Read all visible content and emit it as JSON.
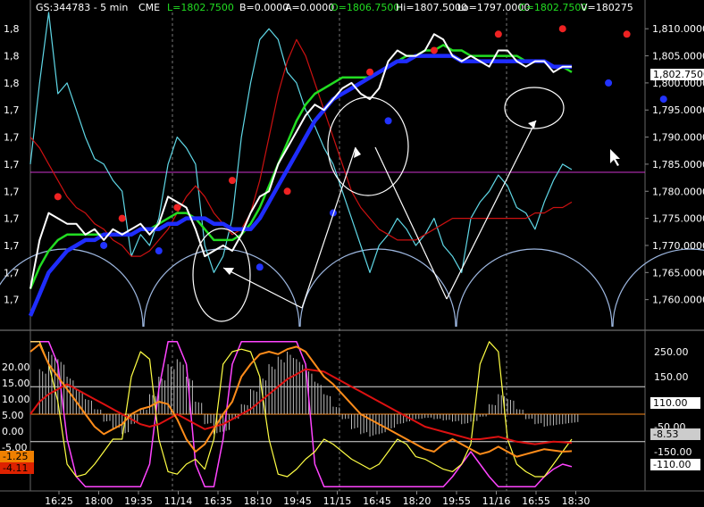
{
  "header": {
    "symbol": "GS:344783 - 5 min",
    "exchange": "CME",
    "last": "L=1802.7500",
    "bid": "B=0.0000",
    "ask": "A=0.0000",
    "open": "O=1806.7500",
    "high": "Hi=1807.5000",
    "low": "Lo=1797.0000",
    "close": "C=1802.7500",
    "volume": "V=180275"
  },
  "colors": {
    "background": "#000000",
    "price": "#ffffff",
    "ma_blue": "#1f2dff",
    "ma_green": "#22dd22",
    "ma_red": "#cc1111",
    "cyan_line": "#5fd7e6",
    "dot_red": "#ee2222",
    "dot_blue": "#2233ff",
    "arcs": "#9db7e0",
    "magenta_level": "#cc33cc",
    "osc_yellow": "#ffff44",
    "osc_orange": "#ff8c1a",
    "osc_red": "#dd1111",
    "osc_magenta": "#ff44ff",
    "osc_histogram": "#bbbbbb"
  },
  "chart_data": [
    {
      "type": "line",
      "panel": "price",
      "right_axis_ticks": [
        "1,810.0000",
        "1,805.0000",
        "1,800.0000",
        "1,795.0000",
        "1,790.0000",
        "1,785.0000",
        "1,780.0000",
        "1,775.0000",
        "1,770.0000",
        "1,765.0000",
        "1,760.0000"
      ],
      "left_axis_ticks": [
        "1,8",
        "1,8",
        "1,8",
        "1,7",
        "1,7",
        "1,7",
        "1,7",
        "1,7",
        "1,7",
        "1,7",
        "1,7"
      ],
      "ylim": [
        1755,
        1813
      ],
      "last_price_tag": "1,802.7500",
      "price_level_line": 1783.5,
      "close_price": [
        1762,
        1771,
        1776,
        1775,
        1774,
        1774,
        1772,
        1773,
        1771,
        1773,
        1772,
        1773,
        1774,
        1772,
        1774,
        1779,
        1778,
        1777,
        1773,
        1768,
        1769,
        1770,
        1769,
        1772,
        1776,
        1779,
        1780,
        1785,
        1788,
        1791,
        1794,
        1796,
        1795,
        1797,
        1799,
        1800,
        1798,
        1797,
        1799,
        1804,
        1806,
        1805,
        1805,
        1806,
        1809,
        1808,
        1805,
        1804,
        1805,
        1804,
        1803,
        1806,
        1806,
        1804,
        1803,
        1804,
        1804,
        1802,
        1803,
        1803
      ],
      "ma_blue": [
        1757,
        1761,
        1765,
        1767,
        1769,
        1770,
        1771,
        1771,
        1772,
        1772,
        1772,
        1772,
        1773,
        1773,
        1773,
        1774,
        1774,
        1775,
        1775,
        1775,
        1774,
        1774,
        1773,
        1773,
        1773,
        1775,
        1778,
        1781,
        1784,
        1787,
        1790,
        1793,
        1795,
        1797,
        1798,
        1799,
        1800,
        1801,
        1802,
        1803,
        1804,
        1804,
        1805,
        1805,
        1805,
        1805,
        1805,
        1804,
        1804,
        1804,
        1804,
        1804,
        1804,
        1804,
        1804,
        1804,
        1804,
        1803,
        1803,
        1803
      ],
      "ma_green": [
        1762,
        1766,
        1769,
        1771,
        1772,
        1772,
        1772,
        1772,
        1772,
        1772,
        1772,
        1772,
        1773,
        1773,
        1774,
        1775,
        1776,
        1776,
        1775,
        1773,
        1771,
        1771,
        1771,
        1772,
        1774,
        1777,
        1781,
        1785,
        1789,
        1793,
        1796,
        1798,
        1799,
        1800,
        1801,
        1801,
        1801,
        1801,
        1802,
        1803,
        1804,
        1805,
        1805,
        1806,
        1806,
        1807,
        1806,
        1806,
        1805,
        1805,
        1805,
        1805,
        1805,
        1805,
        1804,
        1804,
        1804,
        1803,
        1803,
        1802
      ],
      "ma_red": [
        1790,
        1788,
        1785,
        1782,
        1779,
        1777,
        1776,
        1774,
        1773,
        1771,
        1770,
        1768,
        1768,
        1769,
        1771,
        1773,
        1776,
        1779,
        1781,
        1779,
        1776,
        1774,
        1772,
        1773,
        1776,
        1782,
        1790,
        1798,
        1804,
        1808,
        1805,
        1800,
        1795,
        1790,
        1785,
        1780,
        1777,
        1775,
        1773,
        1772,
        1771,
        1771,
        1771,
        1772,
        1773,
        1774,
        1775,
        1775,
        1775,
        1775,
        1775,
        1775,
        1775,
        1775,
        1775,
        1776,
        1776,
        1777,
        1777,
        1778
      ],
      "cyan_line": [
        1785,
        1800,
        1813,
        1798,
        1800,
        1795,
        1790,
        1786,
        1785,
        1782,
        1780,
        1768,
        1772,
        1770,
        1775,
        1785,
        1790,
        1788,
        1785,
        1770,
        1765,
        1768,
        1775,
        1790,
        1800,
        1808,
        1810,
        1808,
        1802,
        1800,
        1795,
        1792,
        1788,
        1785,
        1780,
        1775,
        1770,
        1765,
        1770,
        1772,
        1775,
        1773,
        1770,
        1772,
        1775,
        1770,
        1768,
        1765,
        1775,
        1778,
        1780,
        1783,
        1781,
        1777,
        1776,
        1773,
        1778,
        1782,
        1785,
        1784
      ],
      "red_dots": [
        {
          "x": 3,
          "y": 1779
        },
        {
          "x": 10,
          "y": 1775
        },
        {
          "x": 16,
          "y": 1777
        },
        {
          "x": 22,
          "y": 1782
        },
        {
          "x": 28,
          "y": 1780
        },
        {
          "x": 37,
          "y": 1802
        },
        {
          "x": 44,
          "y": 1806
        },
        {
          "x": 51,
          "y": 1809
        },
        {
          "x": 58,
          "y": 1810
        },
        {
          "x": 65,
          "y": 1809
        }
      ],
      "blue_dots": [
        {
          "x": 8,
          "y": 1770
        },
        {
          "x": 14,
          "y": 1769
        },
        {
          "x": 25,
          "y": 1766
        },
        {
          "x": 33,
          "y": 1776
        },
        {
          "x": 39,
          "y": 1793
        },
        {
          "x": 63,
          "y": 1800
        },
        {
          "x": 69,
          "y": 1797
        }
      ]
    },
    {
      "type": "line",
      "panel": "oscillator",
      "left_axis_ticks": [
        "20.00",
        "15.00",
        "10.00",
        "5.00",
        "0.00",
        "-5.00"
      ],
      "right_axis_ticks": [
        "250.00",
        "150.00",
        "50.00",
        "-50.00",
        "-150.00"
      ],
      "value_tags_left": [
        "-1.25",
        "-4.11"
      ],
      "value_tags_right": [
        "110.00",
        "-8.53",
        "-110.00"
      ],
      "x_ticks": [
        "16:25",
        "18:00",
        "19:35",
        "11/14",
        "16:35",
        "18:10",
        "19:45",
        "11/15",
        "16:45",
        "18:20",
        "19:55",
        "11/16",
        "16:55",
        "18:30"
      ],
      "ylim": [
        -300,
        300
      ],
      "hlines": [
        110,
        -110,
        0
      ],
      "yellow": [
        290,
        290,
        200,
        50,
        -200,
        -250,
        -240,
        -200,
        -150,
        -100,
        -100,
        150,
        250,
        220,
        -100,
        -230,
        -240,
        -200,
        -180,
        -220,
        -100,
        200,
        250,
        260,
        250,
        150,
        -100,
        -240,
        -250,
        -220,
        -180,
        -150,
        -100,
        -120,
        -150,
        -180,
        -200,
        -220,
        -200,
        -150,
        -100,
        -120,
        -170,
        -180,
        -200,
        -220,
        -230,
        -200,
        -120,
        200,
        290,
        250,
        -100,
        -200,
        -230,
        -250,
        -250,
        -200,
        -150,
        -100
      ],
      "orange": [
        250,
        280,
        200,
        150,
        100,
        50,
        0,
        -50,
        -80,
        -60,
        -40,
        0,
        20,
        30,
        50,
        40,
        -20,
        -100,
        -150,
        -120,
        -60,
        0,
        50,
        150,
        200,
        240,
        250,
        240,
        260,
        270,
        250,
        200,
        150,
        120,
        80,
        40,
        0,
        -20,
        -40,
        -60,
        -80,
        -100,
        -120,
        -140,
        -150,
        -120,
        -100,
        -120,
        -140,
        -160,
        -150,
        -130,
        -150,
        -170,
        -160,
        -150,
        -140,
        -145,
        -150,
        -148
      ],
      "red": [
        0,
        50,
        80,
        100,
        120,
        100,
        80,
        60,
        40,
        20,
        0,
        -20,
        -40,
        -50,
        -40,
        -20,
        0,
        -20,
        -40,
        -60,
        -50,
        -40,
        -20,
        0,
        20,
        50,
        80,
        110,
        140,
        160,
        180,
        175,
        170,
        150,
        130,
        110,
        90,
        70,
        50,
        30,
        10,
        -10,
        -30,
        -50,
        -60,
        -70,
        -80,
        -90,
        -100,
        -100,
        -95,
        -90,
        -100,
        -110,
        -115,
        -120,
        -115,
        -110,
        -112,
        -115
      ],
      "magenta": [
        290,
        290,
        290,
        200,
        -100,
        -250,
        -290,
        -290,
        -290,
        -290,
        -290,
        -290,
        -290,
        -200,
        100,
        290,
        290,
        200,
        -200,
        -290,
        -290,
        -100,
        200,
        290,
        290,
        290,
        290,
        290,
        290,
        290,
        200,
        -200,
        -290,
        -290,
        -290,
        -290,
        -290,
        -290,
        -290,
        -290,
        -290,
        -290,
        -290,
        -290,
        -290,
        -290,
        -250,
        -200,
        -150,
        -200,
        -250,
        -290,
        -290,
        -290,
        -290,
        -290,
        -250,
        -220,
        -200,
        -210
      ],
      "histogram": [
        0,
        180,
        250,
        220,
        150,
        100,
        60,
        20,
        -30,
        -60,
        -80,
        -40,
        20,
        80,
        150,
        200,
        220,
        150,
        50,
        -40,
        -80,
        -70,
        -20,
        40,
        100,
        150,
        200,
        230,
        250,
        220,
        180,
        130,
        80,
        30,
        -20,
        -60,
        -80,
        -90,
        -80,
        -60,
        -40,
        -30,
        -20,
        -15,
        -20,
        -25,
        -30,
        -40,
        -30,
        -10,
        40,
        80,
        60,
        20,
        -20,
        -40,
        -50,
        -45,
        -40,
        -35
      ]
    }
  ]
}
